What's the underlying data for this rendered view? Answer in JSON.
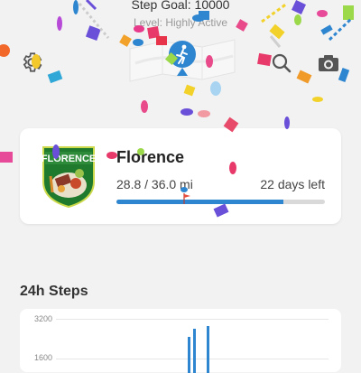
{
  "header": {
    "step_goal": "Step Goal: 10000",
    "level": "Level: Highly Active"
  },
  "toolbar": {
    "settings_icon": "gear-icon",
    "search_icon": "search-icon",
    "camera_icon": "camera-icon",
    "map_icon": "map-walker-icon"
  },
  "challenge_card": {
    "badge_text": "FLORENCE",
    "city": "Florence",
    "distance": "28.8 / 36.0 mi",
    "days_left": "22 days left",
    "progress_fraction": 0.8,
    "progress_color": "#2f86d0"
  },
  "steps_section": {
    "title": "24h Steps",
    "y_ticks": [
      "3200",
      "1600"
    ]
  },
  "colors": {
    "accent": "#2f86d0",
    "background": "#f2f2f2"
  }
}
